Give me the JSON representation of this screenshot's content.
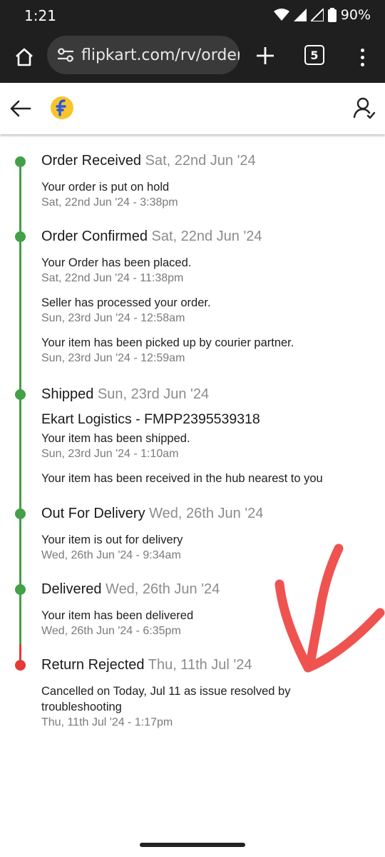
{
  "status_bar": {
    "time": "1:21",
    "battery": "90%"
  },
  "browser": {
    "url": "flipkart.com/rv/orderD",
    "tab_count": "5"
  },
  "stages": [
    {
      "title": "Order Received",
      "date": "Sat, 22nd Jun '24",
      "events": [
        {
          "text": "Your order is put on hold",
          "time": "Sat, 22nd Jun '24 - 3:38pm"
        }
      ]
    },
    {
      "title": "Order Confirmed",
      "date": "Sat, 22nd Jun '24",
      "events": [
        {
          "text": "Your Order has been placed.",
          "time": "Sat, 22nd Jun '24 - 11:38pm"
        },
        {
          "text": "Seller has processed your order.",
          "time": "Sun, 23rd Jun '24 - 12:58am"
        },
        {
          "text": "Your item has been picked up by courier partner.",
          "time": "Sun, 23rd Jun '24 - 12:59am"
        }
      ]
    },
    {
      "title": "Shipped",
      "date": "Sun, 23rd Jun '24",
      "courier": "Ekart Logistics - FMPP2395539318",
      "events": [
        {
          "text": "Your item has been shipped.",
          "time": "Sun, 23rd Jun '24 - 1:10am"
        },
        {
          "text": "Your item has been received in the hub nearest to you"
        }
      ]
    },
    {
      "title": "Out For Delivery",
      "date": "Wed, 26th Jun '24",
      "events": [
        {
          "text": "Your item is out for delivery",
          "time": "Wed, 26th Jun '24 - 9:34am"
        }
      ]
    },
    {
      "title": "Delivered",
      "date": "Wed, 26th Jun '24",
      "events": [
        {
          "text": "Your item has been delivered",
          "time": "Wed, 26th Jun '24 - 6:35pm"
        }
      ]
    },
    {
      "title": "Return Rejected",
      "date": "Thu, 11th Jul '24",
      "events": [
        {
          "text": "Cancelled on Today, Jul 11 as issue resolved by troubleshooting",
          "time": "Thu, 11th Jul '24 - 1:17pm"
        }
      ]
    }
  ],
  "colors": {
    "done": "#43a047",
    "rejected": "#e53935",
    "annotation": "#ef5350",
    "logo_yellow": "#f7c52b",
    "logo_blue": "#2a55e5"
  }
}
